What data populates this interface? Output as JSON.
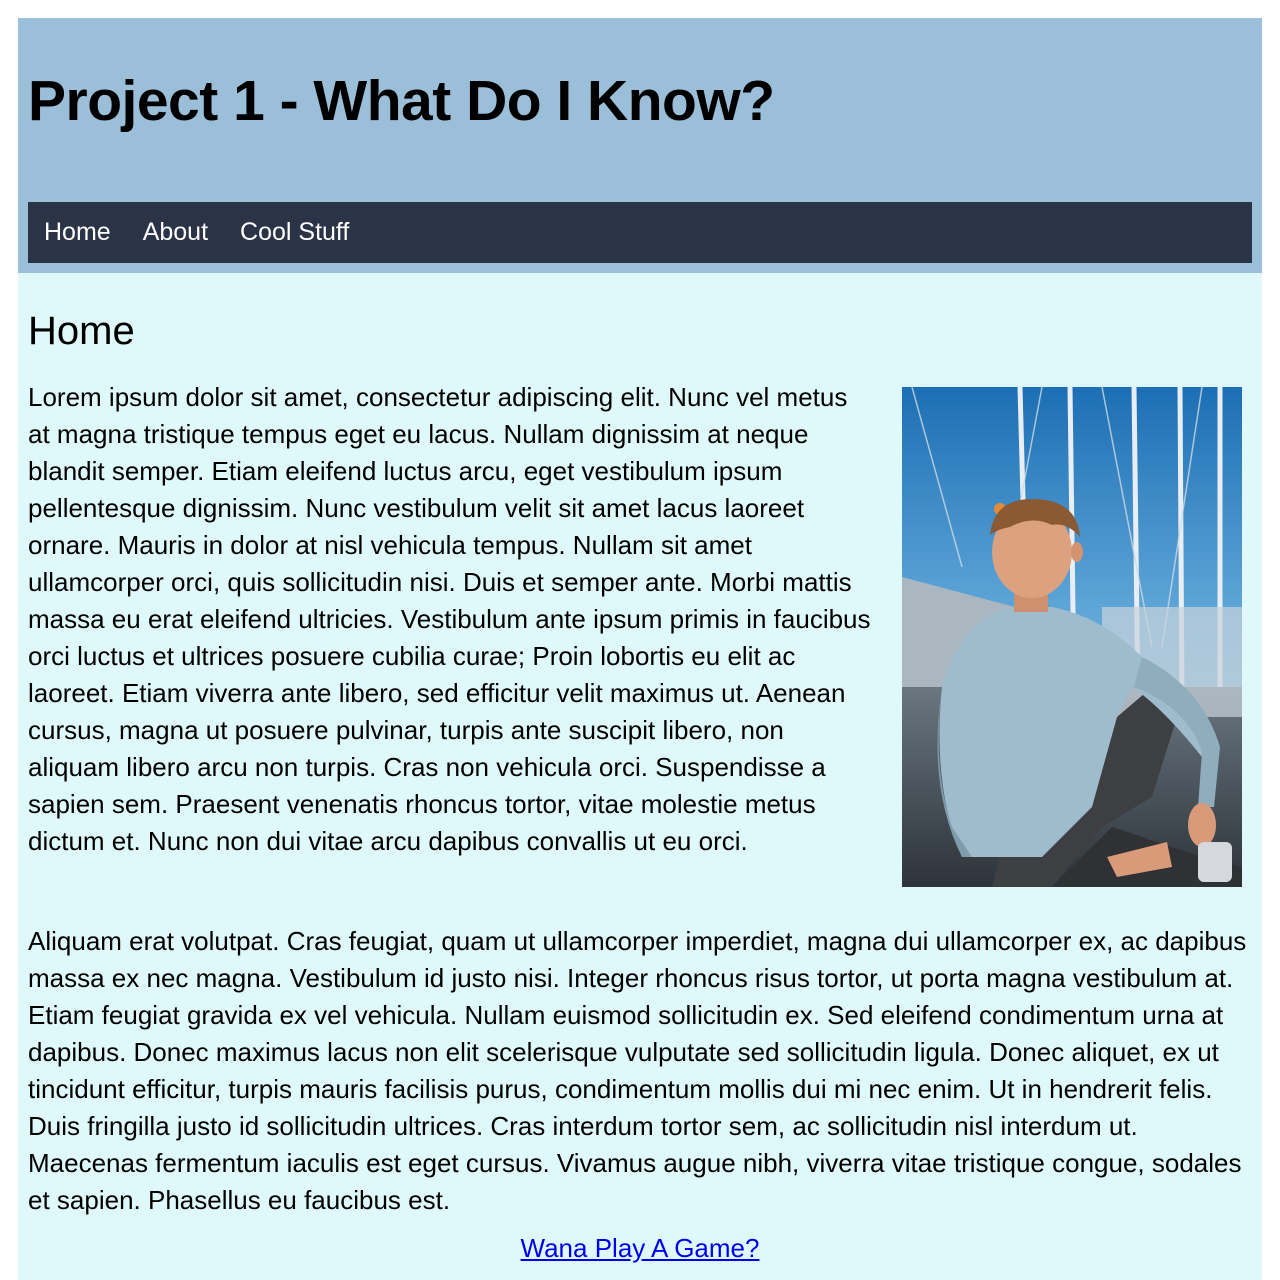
{
  "header": {
    "title": "Project 1 - What Do I Know?"
  },
  "nav": {
    "items": [
      {
        "label": "Home"
      },
      {
        "label": "About"
      },
      {
        "label": "Cool Stuff"
      }
    ]
  },
  "main": {
    "heading": "Home",
    "paragraphs": [
      "Lorem ipsum dolor sit amet, consectetur adipiscing elit. Nunc vel metus at magna tristique tempus eget eu lacus. Nullam dignissim at neque blandit semper. Etiam eleifend luctus arcu, eget vestibulum ipsum pellentesque dignissim. Nunc vestibulum velit sit amet lacus laoreet ornare. Mauris in dolor at nisl vehicula tempus. Nullam sit amet ullamcorper orci, quis sollicitudin nisi. Duis et semper ante. Morbi mattis massa eu erat eleifend ultricies. Vestibulum ante ipsum primis in faucibus orci luctus et ultrices posuere cubilia curae; Proin lobortis eu elit ac laoreet. Etiam viverra ante libero, sed efficitur velit maximus ut. Aenean cursus, magna ut posuere pulvinar, turpis ante suscipit libero, non aliquam libero arcu non turpis. Cras non vehicula orci. Suspendisse a sapien sem. Praesent venenatis rhoncus tortor, vitae molestie metus dictum et. Nunc non dui vitae arcu dapibus convallis ut eu orci.",
      "Aliquam erat volutpat. Cras feugiat, quam ut ullamcorper imperdiet, magna dui ullamcorper ex, ac dapibus massa ex nec magna. Vestibulum id justo nisi. Integer rhoncus risus tortor, ut porta magna vestibulum at. Etiam feugiat gravida ex vel vehicula. Nullam euismod sollicitudin ex. Sed eleifend condimentum urna at dapibus. Donec maximus lacus non elit scelerisque vulputate sed sollicitudin ligula. Donec aliquet, ex ut tincidunt efficitur, turpis mauris facilisis purus, condimentum mollis dui mi nec enim. Ut in hendrerit felis. Duis fringilla justo id sollicitudin ultrices. Cras interdum tortor sem, ac sollicitudin nisl interdum ut. Maecenas fermentum iaculis est eget cursus. Vivamus augue nibh, viverra vitae tristique congue, sodales et sapien. Phasellus eu faucibus est."
    ],
    "link_label": "Wana Play A Game?"
  },
  "colors": {
    "header_bg": "#9bbfd9",
    "nav_bg": "#2b3446",
    "content_bg": "#dff9fa",
    "link": "#0000ee"
  }
}
